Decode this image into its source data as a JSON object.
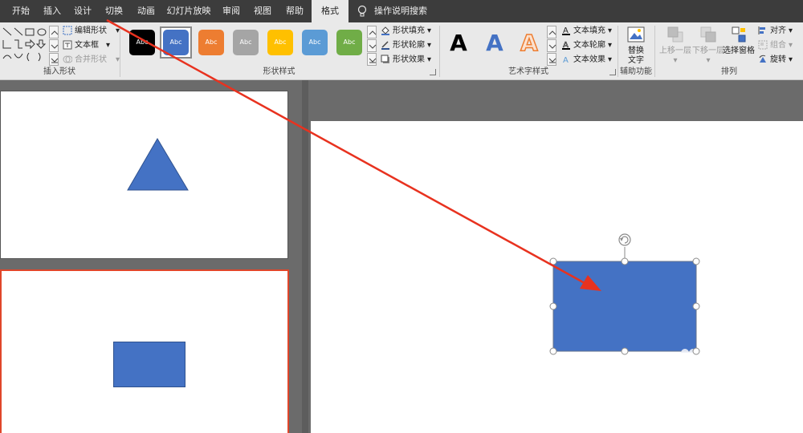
{
  "tabs": [
    "开始",
    "插入",
    "设计",
    "切换",
    "动画",
    "幻灯片放映",
    "审阅",
    "视图",
    "帮助",
    "格式"
  ],
  "active_tab": "格式",
  "tell_me": "操作说明搜索",
  "ribbon": {
    "insert_shapes": {
      "label": "插入形状",
      "edit_shape": "编辑形状",
      "text_box": "文本框",
      "merge_shapes": "合并形状"
    },
    "shape_styles": {
      "label": "形状样式",
      "swatch_text": "Abc",
      "swatch_colors": [
        "#000000",
        "#4472c4",
        "#ed7d31",
        "#a5a5a5",
        "#ffc000",
        "#5b9bd5",
        "#70ad47"
      ],
      "fill": "形状填充",
      "outline": "形状轮廓",
      "effects": "形状效果"
    },
    "wordart_styles": {
      "label": "艺术字样式",
      "letter": "A",
      "text_fill": "文本填充",
      "text_outline": "文本轮廓",
      "text_effects": "文本效果"
    },
    "accessibility": {
      "label": "辅助功能",
      "alt_text_line1": "替换",
      "alt_text_line2": "文字"
    },
    "arrange": {
      "label": "排列",
      "bring_forward": "上移一层",
      "send_backward": "下移一层",
      "selection_pane": "选择窗格",
      "align": "对齐",
      "group": "组合",
      "rotate": "旋转"
    }
  },
  "colors": {
    "shape_blue": "#4472c4",
    "shape_border": "#2f528f",
    "selection_outline": "#e0462a",
    "annotation_arrow": "#e8321f",
    "tabbar_bg": "#3c3c3c",
    "ribbon_bg": "#e9e9e9"
  }
}
